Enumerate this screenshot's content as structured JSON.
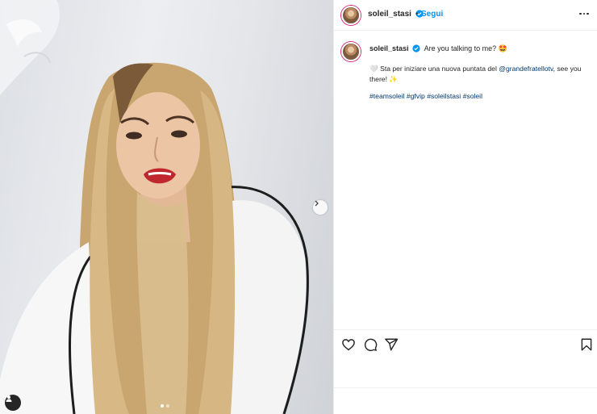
{
  "post": {
    "username": "soleil_stasi",
    "separator": "•",
    "follow_label": "Segui",
    "caption_user": "soleil_stasi",
    "caption_title": "Are you talking to me? 🤩",
    "caption_prefix": "🤍 Sta per iniziare una nuova puntata del ",
    "caption_mention": "@grandefratellotv",
    "caption_suffix": ", see you there! ✨",
    "hashtags": [
      "#teamsoleil",
      "#gfvip",
      "#soleilstasi",
      "#soleil"
    ]
  },
  "carousel": {
    "slides": 2,
    "active_index": 0
  },
  "icons": {
    "more": "more-options-icon",
    "like": "heart-icon",
    "comment": "comment-icon",
    "share": "share-icon",
    "save": "bookmark-icon",
    "next": "chevron-right-icon",
    "tag": "user-tag-icon",
    "verified": "verified-badge-icon"
  },
  "colors": {
    "accent": "#0095f6",
    "mention": "#00376b",
    "text": "#262626",
    "border": "#efefef",
    "lips": "#c0262d"
  }
}
